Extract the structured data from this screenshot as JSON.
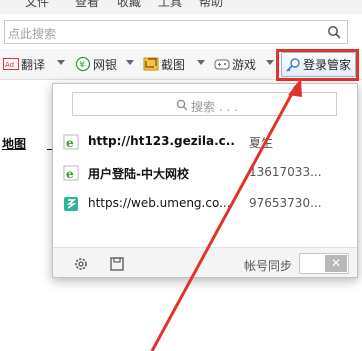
{
  "menubar": {
    "items": [
      "文件",
      "查看",
      "收藏",
      "工具",
      "帮助"
    ]
  },
  "search": {
    "placeholder": "点此搜索"
  },
  "toolbar": {
    "items": [
      {
        "label": "翻译",
        "icon": "translate-icon"
      },
      {
        "label": "网银",
        "icon": "bank-icon"
      },
      {
        "label": "截图",
        "icon": "screenshot-icon"
      },
      {
        "label": "游戏",
        "icon": "game-icon"
      }
    ],
    "login_manager": {
      "label": "登录管家",
      "icon": "key-icon"
    }
  },
  "page": {
    "map_link": "地图"
  },
  "panel": {
    "search_placeholder": "搜索 . . .",
    "rows": [
      {
        "site": "http://ht123.gezila.c...",
        "account": "夏生",
        "bold": true,
        "favicon": "ie-icon"
      },
      {
        "site": "用户登陆-中大网校",
        "account": "13617033...",
        "bold": true,
        "favicon": "ie-icon"
      },
      {
        "site": "https://web.umeng.co...",
        "account": "97653730...",
        "bold": false,
        "favicon": "umeng-icon"
      }
    ],
    "footer": {
      "sync_label": "帐号同步",
      "toggle_off_glyph": "✕"
    }
  },
  "colors": {
    "highlight": "#e0332b",
    "accent": "#3a8ee6",
    "ie": "#3e9a2e"
  }
}
